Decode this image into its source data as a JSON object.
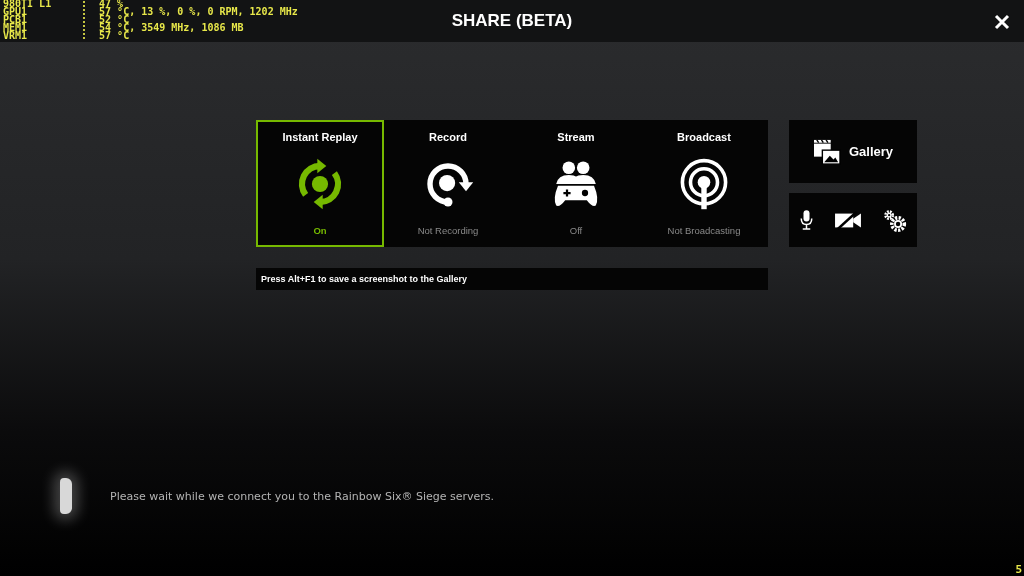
{
  "overlay": {
    "lines": [
      {
        "label": "980TI L1",
        "value": ":  47 %"
      },
      {
        "label": "GPU1",
        "value": ":  57 °C, 13 %, 0 %, 0 RPM, 1202 MHz"
      },
      {
        "label": "PCB1",
        "value": ":  52 °C"
      },
      {
        "label": "MEM1",
        "value": ":  54 °C, 3549 MHz, 1086 MB"
      },
      {
        "label": "VRM1",
        "value": ":  57 °C"
      }
    ]
  },
  "window": {
    "title": "SHARE (BETA)"
  },
  "tiles": [
    {
      "kind": "replay",
      "label": "Instant Replay",
      "status": "On",
      "selected": true
    },
    {
      "kind": "record",
      "label": "Record",
      "status": "Not Recording",
      "selected": false
    },
    {
      "kind": "stream",
      "label": "Stream",
      "status": "Off",
      "selected": false
    },
    {
      "kind": "broadcast",
      "label": "Broadcast",
      "status": "Not Broadcasting",
      "selected": false
    }
  ],
  "gallery": {
    "label": "Gallery"
  },
  "tools": [
    {
      "kind": "mic"
    },
    {
      "kind": "camera-off"
    },
    {
      "kind": "settings"
    }
  ],
  "hint": "Press Alt+F1 to save a screenshot to the Gallery",
  "loading": {
    "message": "Please wait while we connect you to the Rainbow Six® Siege servers."
  },
  "fps": "5"
}
